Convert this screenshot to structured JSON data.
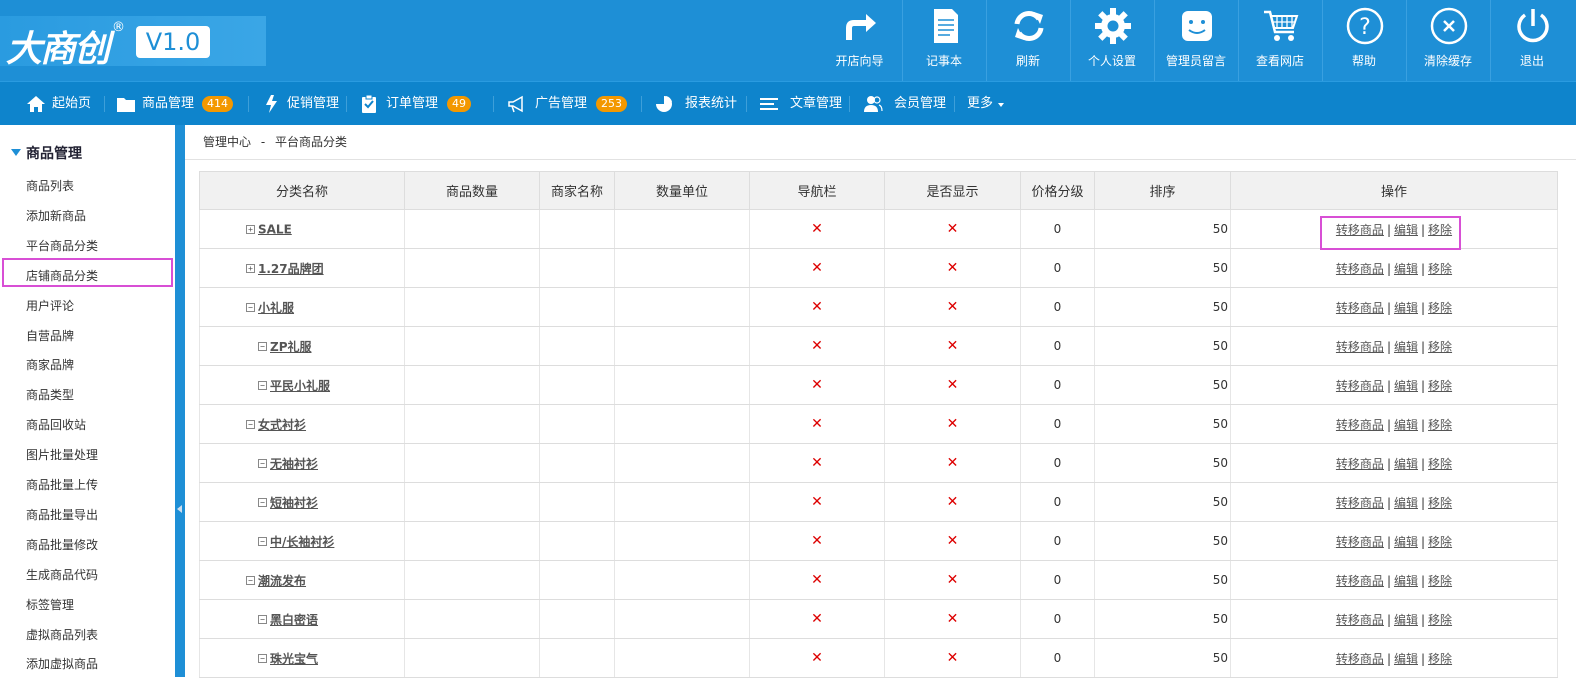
{
  "logo": {
    "brand": "大商创",
    "reg": "®",
    "version": "V1.0"
  },
  "top_buttons": [
    {
      "label": "开店向导",
      "icon": "share-arrow-icon"
    },
    {
      "label": "记事本",
      "icon": "notepad-icon"
    },
    {
      "label": "刷新",
      "icon": "refresh-icon"
    },
    {
      "label": "个人设置",
      "icon": "gear-icon"
    },
    {
      "label": "管理员留言",
      "icon": "message-icon"
    },
    {
      "label": "查看网店",
      "icon": "cart-icon"
    },
    {
      "label": "帮助",
      "icon": "help-icon"
    },
    {
      "label": "清除缓存",
      "icon": "clear-icon"
    },
    {
      "label": "退出",
      "icon": "power-icon"
    }
  ],
  "nav": [
    {
      "label": "起始页",
      "icon": "home-icon"
    },
    {
      "label": "商品管理",
      "icon": "folder-icon",
      "badge": "414"
    },
    {
      "label": "促销管理",
      "icon": "lightning-icon"
    },
    {
      "label": "订单管理",
      "icon": "clipboard-icon",
      "badge": "49"
    },
    {
      "label": "广告管理",
      "icon": "megaphone-icon",
      "badge": "253"
    },
    {
      "label": "报表统计",
      "icon": "pie-chart-icon"
    },
    {
      "label": "文章管理",
      "icon": "list-icon"
    },
    {
      "label": "会员管理",
      "icon": "users-icon"
    },
    {
      "label": "更多",
      "icon": "caret-down-icon"
    }
  ],
  "sidebar": {
    "title": "商品管理",
    "items": [
      "商品列表",
      "添加新商品",
      "平台商品分类",
      "店铺商品分类",
      "用户评论",
      "自营品牌",
      "商家品牌",
      "商品类型",
      "商品回收站",
      "图片批量处理",
      "商品批量上传",
      "商品批量导出",
      "商品批量修改",
      "生成商品代码",
      "标签管理",
      "虚拟商品列表",
      "添加虚拟商品"
    ],
    "highlighted_item": "店铺商品分类"
  },
  "breadcrumb": {
    "root": "管理中心",
    "sep": "-",
    "current": "平台商品分类"
  },
  "table": {
    "headers": [
      "分类名称",
      "商品数量",
      "商家名称",
      "数量单位",
      "导航栏",
      "是否显示",
      "价格分级",
      "排序",
      "操作"
    ],
    "mark_x": "✕",
    "ops": [
      "转移商品",
      "编辑",
      "移除"
    ],
    "op_sep": "|",
    "rows": [
      {
        "toggle": "+",
        "name": "SALE",
        "level": 0,
        "price_grade": "0",
        "sort": "50"
      },
      {
        "toggle": "+",
        "name": "1.27品牌团",
        "level": 0,
        "price_grade": "0",
        "sort": "50"
      },
      {
        "toggle": "−",
        "name": "小礼服",
        "level": 0,
        "price_grade": "0",
        "sort": "50"
      },
      {
        "toggle": "−",
        "name": "ZP礼服",
        "level": 1,
        "price_grade": "0",
        "sort": "50"
      },
      {
        "toggle": "−",
        "name": "平民小礼服",
        "level": 1,
        "price_grade": "0",
        "sort": "50"
      },
      {
        "toggle": "−",
        "name": "女式衬衫",
        "level": 0,
        "price_grade": "0",
        "sort": "50"
      },
      {
        "toggle": "−",
        "name": "无袖衬衫",
        "level": 1,
        "price_grade": "0",
        "sort": "50"
      },
      {
        "toggle": "−",
        "name": "短袖衬衫",
        "level": 1,
        "price_grade": "0",
        "sort": "50"
      },
      {
        "toggle": "−",
        "name": "中/长袖衬衫",
        "level": 1,
        "price_grade": "0",
        "sort": "50"
      },
      {
        "toggle": "−",
        "name": "潮流发布",
        "level": 0,
        "price_grade": "0",
        "sort": "50"
      },
      {
        "toggle": "−",
        "name": "黑白密语",
        "level": 1,
        "price_grade": "0",
        "sort": "50"
      },
      {
        "toggle": "−",
        "name": "珠光宝气",
        "level": 1,
        "price_grade": "0",
        "sort": "50"
      }
    ]
  },
  "colors": {
    "topbar": "#1e8fd6",
    "navbar": "#0e84cc",
    "badge": "#f39800",
    "highlight": "#d84fd5",
    "x_mark": "#dd0000"
  }
}
